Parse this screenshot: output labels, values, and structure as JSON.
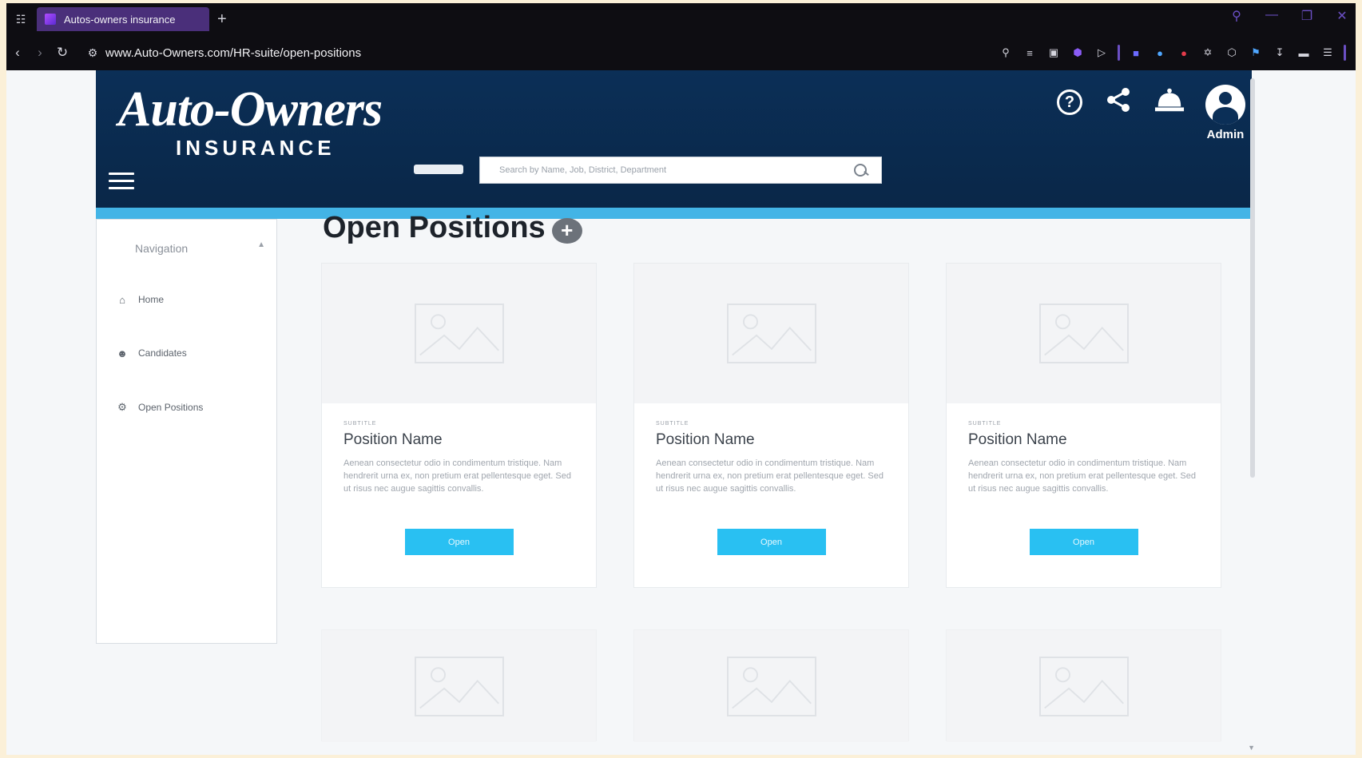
{
  "browser": {
    "tab_title": "Autos-owners insurance",
    "url": "www.Auto-Owners.com/HR-suite/open-positions"
  },
  "header": {
    "logo_main": "Auto-Owners",
    "logo_sub": "INSURANCE",
    "search_placeholder": "Search by Name, Job, District, Department",
    "admin_label": "Admin"
  },
  "sidebar": {
    "title": "Navigation",
    "items": [
      {
        "label": "Home",
        "icon": "home-icon"
      },
      {
        "label": "Candidates",
        "icon": "person-icon"
      },
      {
        "label": "Open Positions",
        "icon": "gear-icon"
      }
    ]
  },
  "main": {
    "title": "Open Positions",
    "cards": [
      {
        "subtitle": "SUBTITLE",
        "title": "Position Name",
        "description": "Aenean consectetur odio in condimentum tristique. Nam hendrerit urna ex, non pretium erat pellentesque eget. Sed ut risus nec augue sagittis convallis.",
        "button": "Open"
      },
      {
        "subtitle": "SUBTITLE",
        "title": "Position Name",
        "description": "Aenean consectetur odio in condimentum tristique. Nam hendrerit urna ex, non pretium erat pellentesque eget. Sed ut risus nec augue sagittis convallis.",
        "button": "Open"
      },
      {
        "subtitle": "SUBTITLE",
        "title": "Position Name",
        "description": "Aenean consectetur odio in condimentum tristique. Nam hendrerit urna ex, non pretium erat pellentesque eget. Sed ut risus nec augue sagittis convallis.",
        "button": "Open"
      }
    ]
  },
  "colors": {
    "header_bg": "#0b2f57",
    "accent_stripe": "#43b4e6",
    "button": "#29c0f2"
  }
}
